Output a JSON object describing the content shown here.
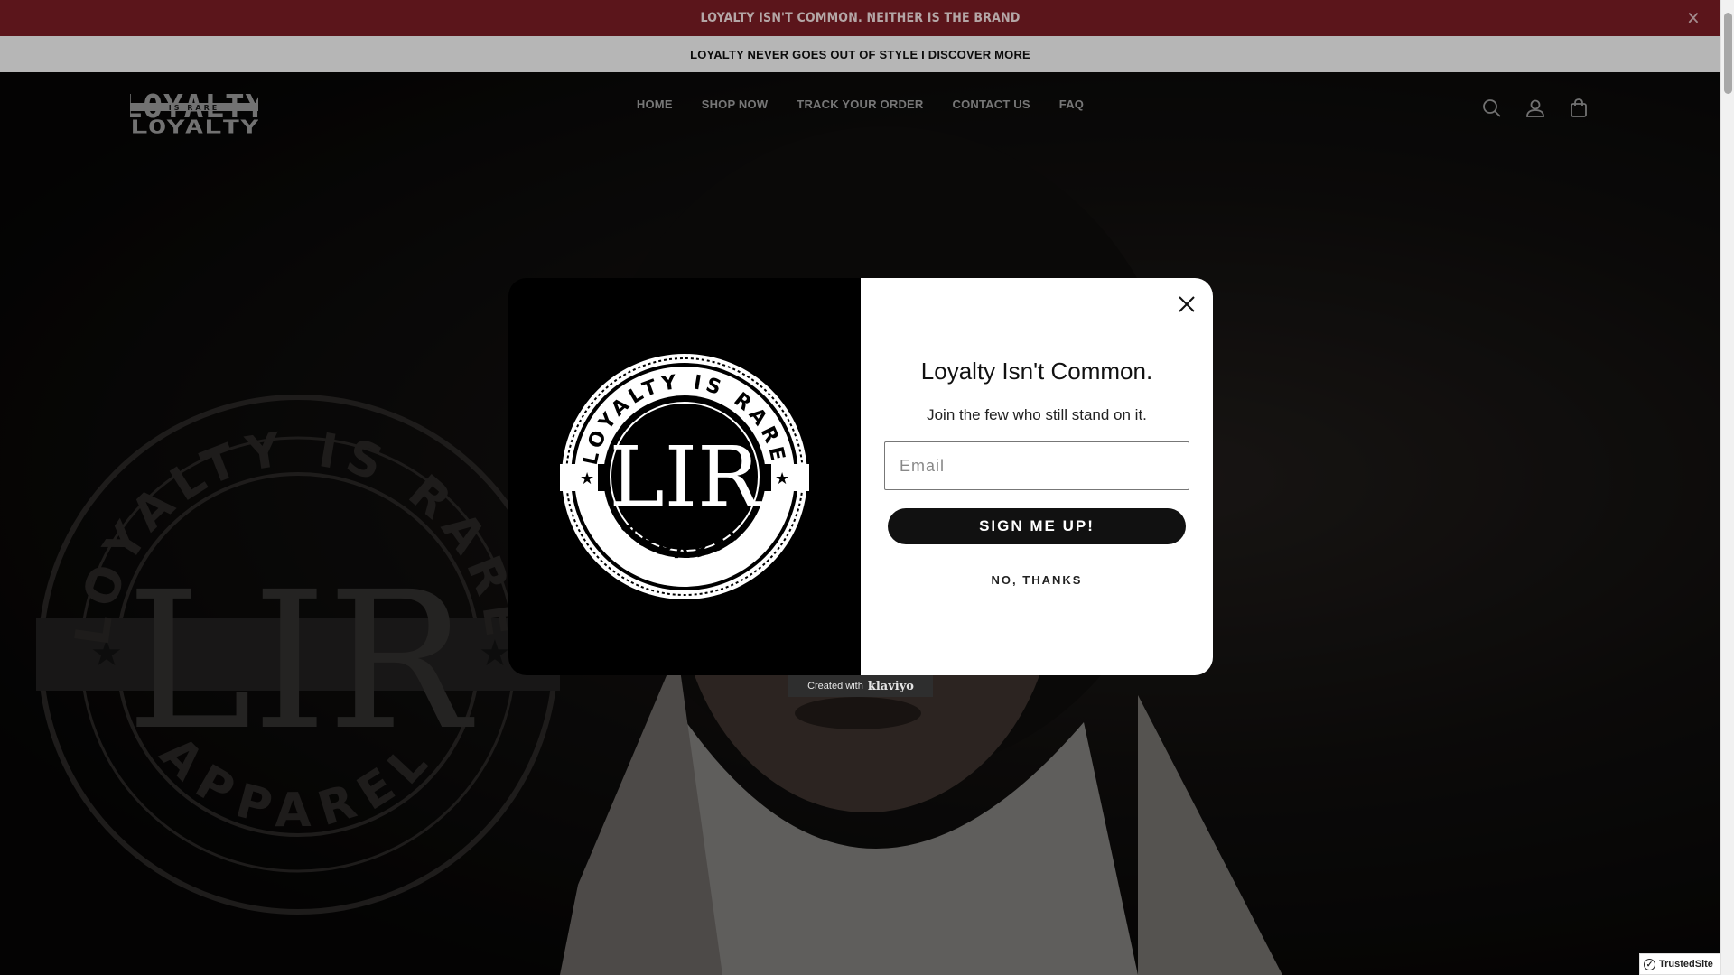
{
  "announcement": {
    "primary_text": "LOYALTY ISN'T COMMON. NEITHER IS THE BRAND",
    "secondary_text": "LOYALTY NEVER GOES OUT OF STYLE I DISCOVER MORE",
    "close_icon": "close-icon"
  },
  "header": {
    "logo_text": "LOYALTY",
    "logo_subtext": "IS RARE",
    "nav": [
      {
        "label": "HOME"
      },
      {
        "label": "SHOP NOW"
      },
      {
        "label": "TRACK YOUR ORDER"
      },
      {
        "label": "CONTACT US"
      },
      {
        "label": "FAQ"
      }
    ],
    "icons": [
      "search-icon",
      "account-icon",
      "cart-icon"
    ]
  },
  "hero": {
    "emblem_top_text": "LOYALTY IS RARE",
    "emblem_bottom_text": "APPAREL",
    "emblem_monogram": "LIR"
  },
  "popup": {
    "badge_top_text": "LOYALTY IS RARE",
    "badge_bottom_text": "APPAREL",
    "badge_monogram": "LIR",
    "title": "Loyalty Isn't Common.",
    "subtitle": "Join the few who still stand on it.",
    "email_placeholder": "Email",
    "submit_label": "SIGN ME UP!",
    "decline_label": "NO, THANKS"
  },
  "footer_badges": {
    "klaviyo_prefix": "Created with",
    "klaviyo_brand": "klaviyo",
    "trusted_site": "TrustedSite"
  },
  "colors": {
    "announcement_bg": "#7a1c24",
    "secondary_bar_bg": "#f3f3f3",
    "popup_button_bg": "#111111"
  }
}
